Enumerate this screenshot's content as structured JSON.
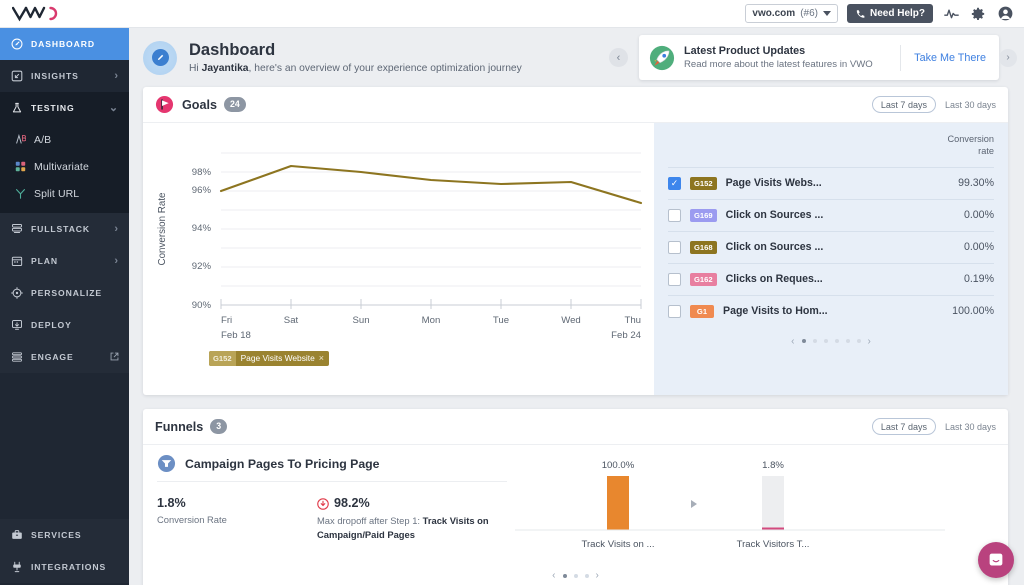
{
  "topbar": {
    "logo_alt": "VWO",
    "site_name": "vwo.com",
    "site_id": "(#6)",
    "need_help": "Need Help?",
    "icons": [
      "pulse-icon",
      "gear-icon",
      "account-icon"
    ]
  },
  "page_header": {
    "title": "Dashboard",
    "greeting_prefix": "Hi ",
    "user_name": "Jayantika",
    "greeting_suffix": ", here's an overview of your experience optimization journey",
    "collapse_label": "‹"
  },
  "promo": {
    "icon": "rocket-icon",
    "title": "Latest Product Updates",
    "subtitle": "Read more about the latest features in VWO",
    "cta": "Take Me There",
    "next_label": "›"
  },
  "sidebar": {
    "items": [
      {
        "label": "DASHBOARD",
        "icon": "gauge-icon",
        "state": "active",
        "chevron": ""
      },
      {
        "label": "INSIGHTS",
        "icon": "insights-icon",
        "state": "normal",
        "chevron": "›"
      },
      {
        "label": "TESTING",
        "icon": "flask-icon",
        "state": "open",
        "chevron": "⌄"
      },
      {
        "label": "FULLSTACK",
        "icon": "stack-icon",
        "state": "dim",
        "chevron": "›"
      },
      {
        "label": "PLAN",
        "icon": "calendar-icon",
        "state": "dim",
        "chevron": "›"
      },
      {
        "label": "PERSONALIZE",
        "icon": "target-icon",
        "state": "dim",
        "chevron": ""
      },
      {
        "label": "DEPLOY",
        "icon": "deploy-icon",
        "state": "dim",
        "chevron": ""
      },
      {
        "label": "ENGAGE",
        "icon": "engage-icon",
        "state": "dim",
        "chevron": "external"
      }
    ],
    "sub_items": [
      {
        "label": "A/B",
        "icon": "ab-test-icon"
      },
      {
        "label": "Multivariate",
        "icon": "multivariate-icon"
      },
      {
        "label": "Split URL",
        "icon": "split-url-icon"
      }
    ],
    "bottom_items": [
      {
        "label": "SERVICES",
        "icon": "briefcase-icon"
      },
      {
        "label": "INTEGRATIONS",
        "icon": "integrations-icon"
      }
    ]
  },
  "goals_card": {
    "icon": "goal-flag-icon",
    "title": "Goals",
    "count": "24",
    "range_selected": "Last 7 days",
    "range_other": "Last 30 days",
    "conversion_head_line1": "Conversion",
    "conversion_head_line2": "rate",
    "legend": {
      "id": "G152",
      "name": "Page Visits Website",
      "close": "×"
    },
    "rows": [
      {
        "checked": true,
        "id": "G152",
        "color": "#8d7520",
        "name": "Page Visits Webs...",
        "rate": "99.30%"
      },
      {
        "checked": false,
        "id": "G169",
        "color": "#9b9bf0",
        "name": "Click on Sources ...",
        "rate": "0.00%"
      },
      {
        "checked": false,
        "id": "G168",
        "color": "#8d7520",
        "name": "Click on Sources ...",
        "rate": "0.00%"
      },
      {
        "checked": false,
        "id": "G162",
        "color": "#e87fa0",
        "name": "Clicks on Reques...",
        "rate": "0.19%"
      },
      {
        "checked": false,
        "id": "G1",
        "color": "#f08a50",
        "name": "Page Visits to Hom...",
        "rate": "100.00%"
      }
    ],
    "pager": {
      "prev": "‹",
      "next": "›",
      "dots": 6,
      "active": 0
    }
  },
  "funnels_card": {
    "title": "Funnels",
    "count": "3",
    "range_selected": "Last 7 days",
    "range_other": "Last 30 days",
    "funnel_icon": "funnel-icon",
    "funnel_name": "Campaign Pages To Pricing Page",
    "conversion_rate_value": "1.8%",
    "conversion_rate_label": "Conversion Rate",
    "dropoff_icon": "dropoff-icon",
    "dropoff_value": "98.2%",
    "dropoff_label_prefix": "Max dropoff after Step 1: ",
    "dropoff_label_bold": "Track Visits on Campaign/Paid Pages",
    "pager": {
      "prev": "‹",
      "next": "›",
      "dots": 4,
      "active": 0
    }
  },
  "chat": {
    "icon": "chat-icon"
  },
  "chart_data": [
    {
      "type": "line",
      "title": "",
      "ylabel": "Conversion Rate",
      "xlabel": "",
      "categories": [
        "Fri",
        "Sat",
        "Sun",
        "Mon",
        "Tue",
        "Wed",
        "Thu"
      ],
      "x_sublabels": [
        "Feb 18",
        "",
        "",
        "",
        "",
        "",
        "Feb 24"
      ],
      "ytick_labels": [
        "90%",
        "92%",
        "94%",
        "96%",
        "98%"
      ],
      "ylim": [
        89.0,
        99.3
      ],
      "grid": true,
      "legend_position": "bottom-left",
      "series": [
        {
          "name": "Page Visits Website",
          "id": "G152",
          "color": "#8d7520",
          "values": [
            96.9,
            98.2,
            97.9,
            97.5,
            97.3,
            97.4,
            96.3
          ]
        }
      ]
    },
    {
      "type": "bar",
      "title": "Campaign Pages To Pricing Page",
      "categories": [
        "Track Visits on ...",
        "Track Visitors T..."
      ],
      "values": [
        100.0,
        1.8
      ],
      "data_labels": [
        "100.0%",
        "1.8%"
      ],
      "colors": [
        "#e8872e",
        "#d34a7e"
      ],
      "track_color": "#edeef0",
      "ylim": [
        0,
        100
      ],
      "grid": false,
      "arrow_between": true
    }
  ]
}
